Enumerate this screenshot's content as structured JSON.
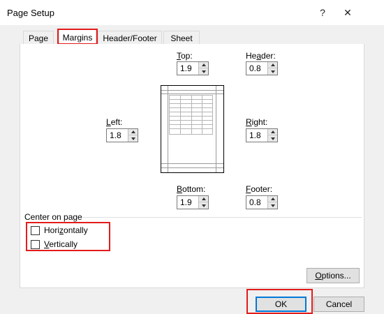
{
  "window": {
    "title": "Page Setup",
    "help_glyph": "?",
    "close_glyph": "✕"
  },
  "tabs": [
    {
      "label": "Page"
    },
    {
      "label": "Margins"
    },
    {
      "label": "Header/Footer"
    },
    {
      "label": "Sheet"
    }
  ],
  "active_tab": "Margins",
  "margins": {
    "top": {
      "label_u": "T",
      "label_rest": "op:",
      "value": "1.9"
    },
    "header": {
      "label_pre": "He",
      "label_u": "a",
      "label_rest": "der:",
      "value": "0.8"
    },
    "left": {
      "label_u": "L",
      "label_rest": "eft:",
      "value": "1.8"
    },
    "right": {
      "label_u": "R",
      "label_rest": "ight:",
      "value": "1.8"
    },
    "bottom": {
      "label_u": "B",
      "label_rest": "ottom:",
      "value": "1.9"
    },
    "footer": {
      "label_u": "F",
      "label_rest": "ooter:",
      "value": "0.8"
    }
  },
  "center_on_page": {
    "title": "Center on page",
    "horizontally": {
      "label_pre": "Hori",
      "label_u": "z",
      "label_rest": "ontally",
      "checked": false
    },
    "vertically": {
      "label_u": "V",
      "label_rest": "ertically",
      "checked": false
    }
  },
  "buttons": {
    "options": {
      "label_u": "O",
      "label_rest": "ptions..."
    },
    "ok": "OK",
    "cancel": "Cancel"
  },
  "highlight_color": "#e41b1b",
  "accent_color": "#0078d7"
}
